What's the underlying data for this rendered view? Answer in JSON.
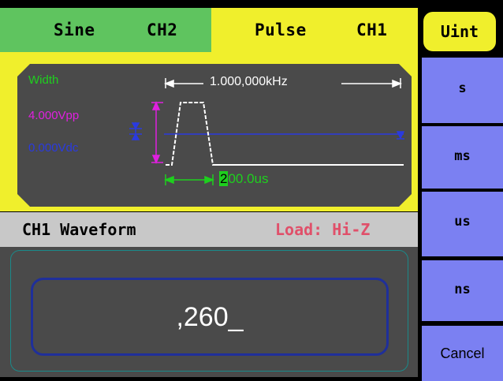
{
  "tabs": {
    "ch2": {
      "wave": "Sine",
      "channel": "CH2",
      "color": "#5fc45f"
    },
    "ch1": {
      "wave": "Pulse",
      "channel": "CH1",
      "color": "#f0ef2c"
    }
  },
  "waveform_display": {
    "params": {
      "width": "Width",
      "amplitude": "4.000Vpp",
      "offset": "0.000Vdc"
    },
    "frequency_label": "1.000,000kHz",
    "width_label_highlight": "2",
    "width_label_rest": "00.0us"
  },
  "status": {
    "title": "CH1 Waveform",
    "load": "Load: Hi-Z"
  },
  "input": {
    "value": ",260_"
  },
  "softkeys": {
    "title": "Uint",
    "items": [
      "s",
      "ms",
      "us",
      "ns",
      "Cancel"
    ]
  },
  "colors": {
    "accent": "#f0ef2c",
    "softkey": "#7b80f2",
    "trace": "#ffffff",
    "marker_green": "#1ed01e",
    "marker_magenta": "#e020e0",
    "marker_blue": "#1f2fd0"
  }
}
